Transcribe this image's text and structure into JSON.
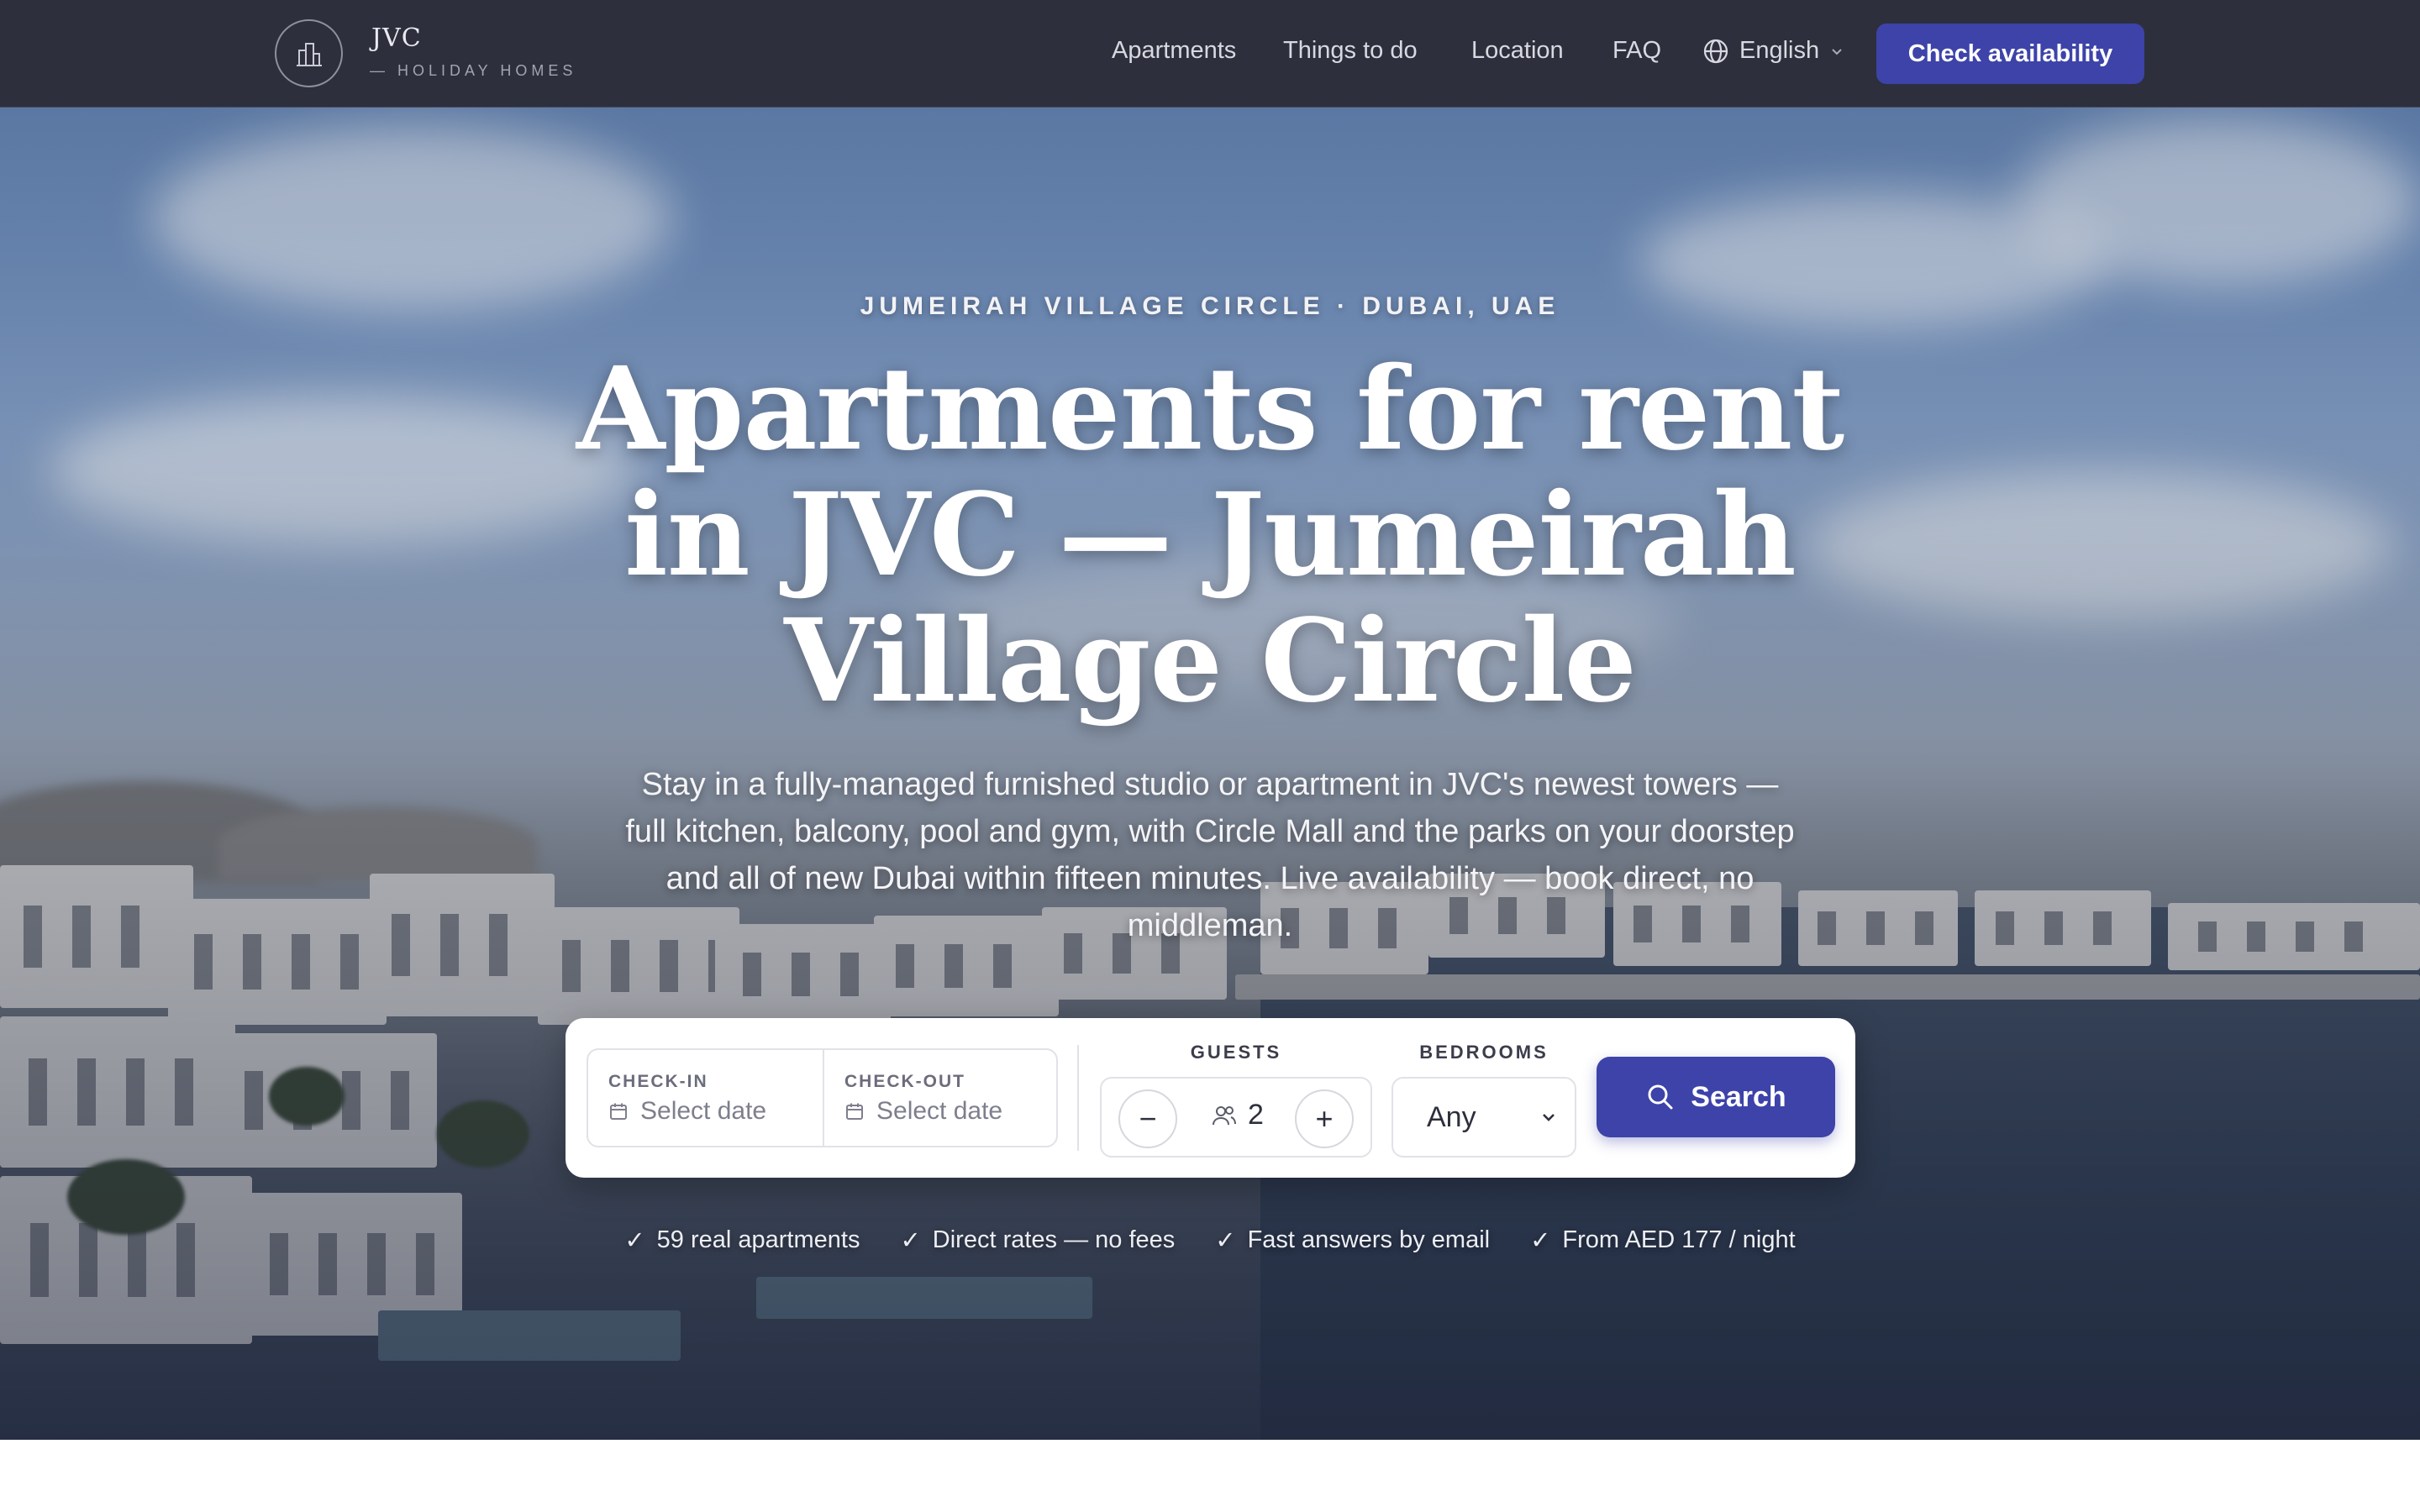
{
  "brand": {
    "title": "JVC",
    "subtitle": "— HOLIDAY HOMES",
    "logo_icon": "city-buildings-icon"
  },
  "nav": {
    "links": [
      "Apartments",
      "Things to do",
      "Location",
      "FAQ"
    ],
    "language": "English",
    "cta_label": "Check availability"
  },
  "hero": {
    "eyebrow": "JUMEIRAH VILLAGE CIRCLE · DUBAI, UAE",
    "headline": "Apartments for rent in JVC — Jumeirah Village Circle",
    "lede": "Stay in a fully-managed furnished studio or apartment in JVC's newest towers — full kitchen, balcony, pool and gym, with Circle Mall and the parks on your doorstep and all of new Dubai within fifteen minutes. Live availability — book direct, no middleman."
  },
  "search": {
    "checkin_label": "CHECK-IN",
    "checkin_value": "Select date",
    "checkout_label": "CHECK-OUT",
    "checkout_value": "Select date",
    "guests_label": "GUESTS",
    "guests_value": "2",
    "minus": "−",
    "plus": "+",
    "bedrooms_label": "BEDROOMS",
    "bedrooms_value": "Any",
    "button_label": "Search"
  },
  "trust": [
    "59 real apartments",
    "Direct rates — no fees",
    "Fast answers by email",
    "From AED 177 / night"
  ],
  "trust_mark": "✓",
  "colors": {
    "nav_bg": "#2d2f3d",
    "accent": "#3d43a8",
    "card_bg": "#ffffff"
  }
}
